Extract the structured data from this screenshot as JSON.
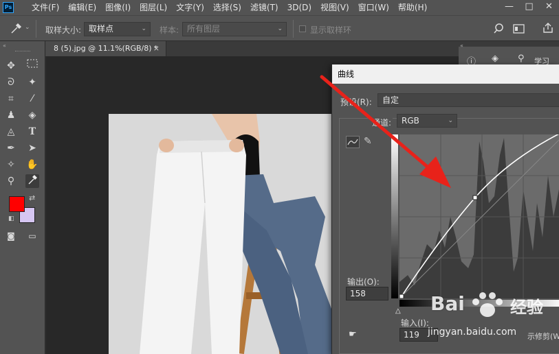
{
  "menubar": {
    "logo": "Ps",
    "items": [
      "文件(F)",
      "编辑(E)",
      "图像(I)",
      "图层(L)",
      "文字(Y)",
      "选择(S)",
      "滤镜(T)",
      "3D(D)",
      "视图(V)",
      "窗口(W)",
      "帮助(H)"
    ],
    "window_controls": [
      "—",
      "□",
      "✕"
    ]
  },
  "optbar": {
    "sample_size_label": "取样大小:",
    "sample_size_value": "取样点",
    "sample_label": "样本:",
    "sample_value": "所有图层",
    "show_ring_label": "显示取样环"
  },
  "document": {
    "tab_title": "8 (5).jpg @ 11.1%(RGB/8) *",
    "close": "×"
  },
  "right_panel": {
    "learn_label": "学习"
  },
  "curves": {
    "title": "曲线",
    "preset_label": "预设(R):",
    "preset_value": "自定",
    "channel_label": "通道:",
    "channel_value": "RGB",
    "output_label": "输出(O):",
    "output_value": "158",
    "input_label": "输入(I):",
    "input_value": "119",
    "show_clipping_label": "示修剪(W)"
  },
  "watermark": {
    "brand": "Bai",
    "brand_cn": "经验",
    "url": "jingyan.baidu.com"
  },
  "colors": {
    "foreground": "#ff0000",
    "background": "#d6c6f2",
    "arrow": "#e8221a"
  }
}
